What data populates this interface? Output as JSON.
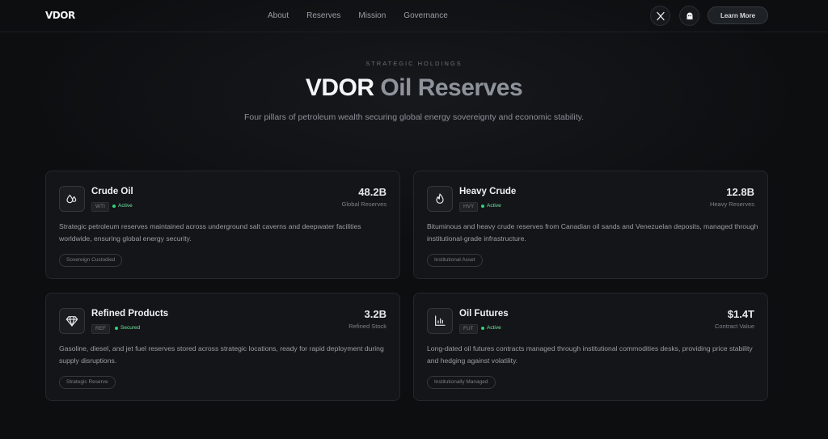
{
  "nav": {
    "logo": "VDOR",
    "links": [
      "About",
      "Reserves",
      "Mission",
      "Governance"
    ],
    "social": [
      {
        "icon": "x-icon"
      },
      {
        "icon": "ghost-icon"
      }
    ],
    "cta": "Learn More"
  },
  "hero": {
    "eyebrow": "STRATEGIC HOLDINGS",
    "title_main": "VDOR",
    "title_accent": "Oil Reserves",
    "subtitle": "Four pillars of petroleum wealth securing global energy sovereignty and economic stability."
  },
  "colors": {
    "background": "#0d0e10",
    "card": "#141518",
    "accent_text": "#8e939b",
    "status_green": "#34d27a"
  },
  "cards": [
    {
      "icon": "droplets-icon",
      "name": "Crude Oil",
      "code": "WTI",
      "status": "Active",
      "value": "48.2B",
      "value_label": "Global Reserves",
      "description": "Strategic petroleum reserves maintained across underground salt caverns and deepwater facilities worldwide, ensuring global energy security.",
      "tag": "Sovereign Custodied"
    },
    {
      "icon": "flame-icon",
      "name": "Heavy Crude",
      "code": "HVY",
      "status": "Active",
      "value": "12.8B",
      "value_label": "Heavy Reserves",
      "description": "Bituminous and heavy crude reserves from Canadian oil sands and Venezuelan deposits, managed through institutional-grade infrastructure.",
      "tag": "Institutional Asset"
    },
    {
      "icon": "gem-icon",
      "name": "Refined Products",
      "code": "REF",
      "status": "Secured",
      "value": "3.2B",
      "value_label": "Refined Stock",
      "description": "Gasoline, diesel, and jet fuel reserves stored across strategic locations, ready for rapid deployment during supply disruptions.",
      "tag": "Strategic Reserve"
    },
    {
      "icon": "bar-chart-icon",
      "name": "Oil Futures",
      "code": "FUT",
      "status": "Active",
      "value": "$1.4T",
      "value_label": "Contract Value",
      "description": "Long-dated oil futures contracts managed through institutional commodities desks, providing price stability and hedging against volatility.",
      "tag": "Institutionally Managed"
    }
  ]
}
